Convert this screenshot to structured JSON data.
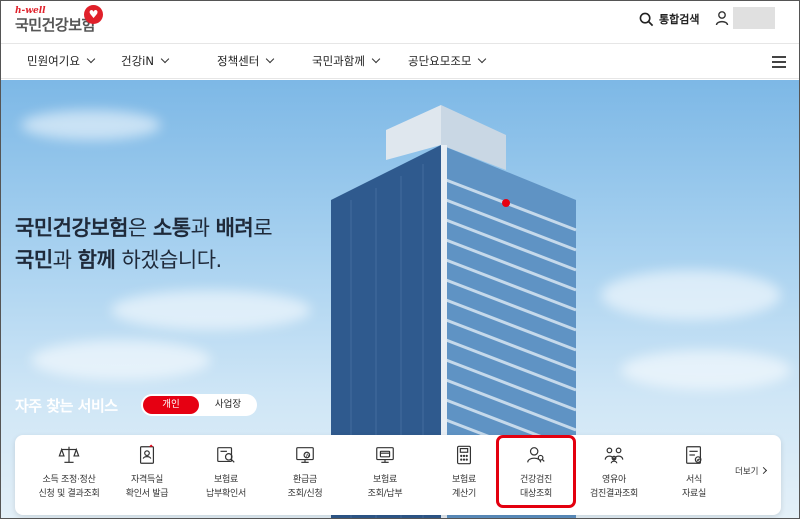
{
  "logo": {
    "sub": "h-well",
    "main": "국민건강보험"
  },
  "header": {
    "search_label": "통합검색"
  },
  "nav": {
    "items": [
      {
        "label": "민원여기요"
      },
      {
        "label": "건강iN"
      },
      {
        "label": "정책센터"
      },
      {
        "label": "국민과함께"
      },
      {
        "label": "공단요모조모"
      }
    ]
  },
  "hero": {
    "line1_b1": "국민건강보험",
    "line1_t1": "은 ",
    "line1_b2": "소통",
    "line1_t2": "과 ",
    "line1_b3": "배려",
    "line1_t3": "로",
    "line2_b1": "국민",
    "line2_t1": "과 ",
    "line2_b2": "함께",
    "line2_t2": " 하겠습니다."
  },
  "services": {
    "title": "자주 찾는 서비스",
    "toggle_on": "개인",
    "toggle_off": "사업장",
    "more_label": "더보기",
    "items": [
      {
        "line1": "소득 조정·정산",
        "line2": "신청 및 결과조회",
        "icon": "scale-icon"
      },
      {
        "line1": "자격득실",
        "line2": "확인서 발급",
        "icon": "document-person-icon"
      },
      {
        "line1": "보험료",
        "line2": "납부확인서",
        "icon": "receipt-search-icon"
      },
      {
        "line1": "환급금",
        "line2": "조회/신청",
        "icon": "monitor-coin-icon"
      },
      {
        "line1": "보험료",
        "line2": "조회/납부",
        "icon": "monitor-card-icon"
      },
      {
        "line1": "보험료",
        "line2": "계산기",
        "icon": "calculator-icon"
      },
      {
        "line1": "건강검진",
        "line2": "대상조회",
        "icon": "person-search-icon"
      },
      {
        "line1": "영유아",
        "line2": "검진결과조회",
        "icon": "family-icon"
      },
      {
        "line1": "서식",
        "line2": "자료실",
        "icon": "form-document-icon"
      }
    ]
  },
  "colors": {
    "brand_red": "#e60012",
    "highlight_red": "#e3000f"
  }
}
